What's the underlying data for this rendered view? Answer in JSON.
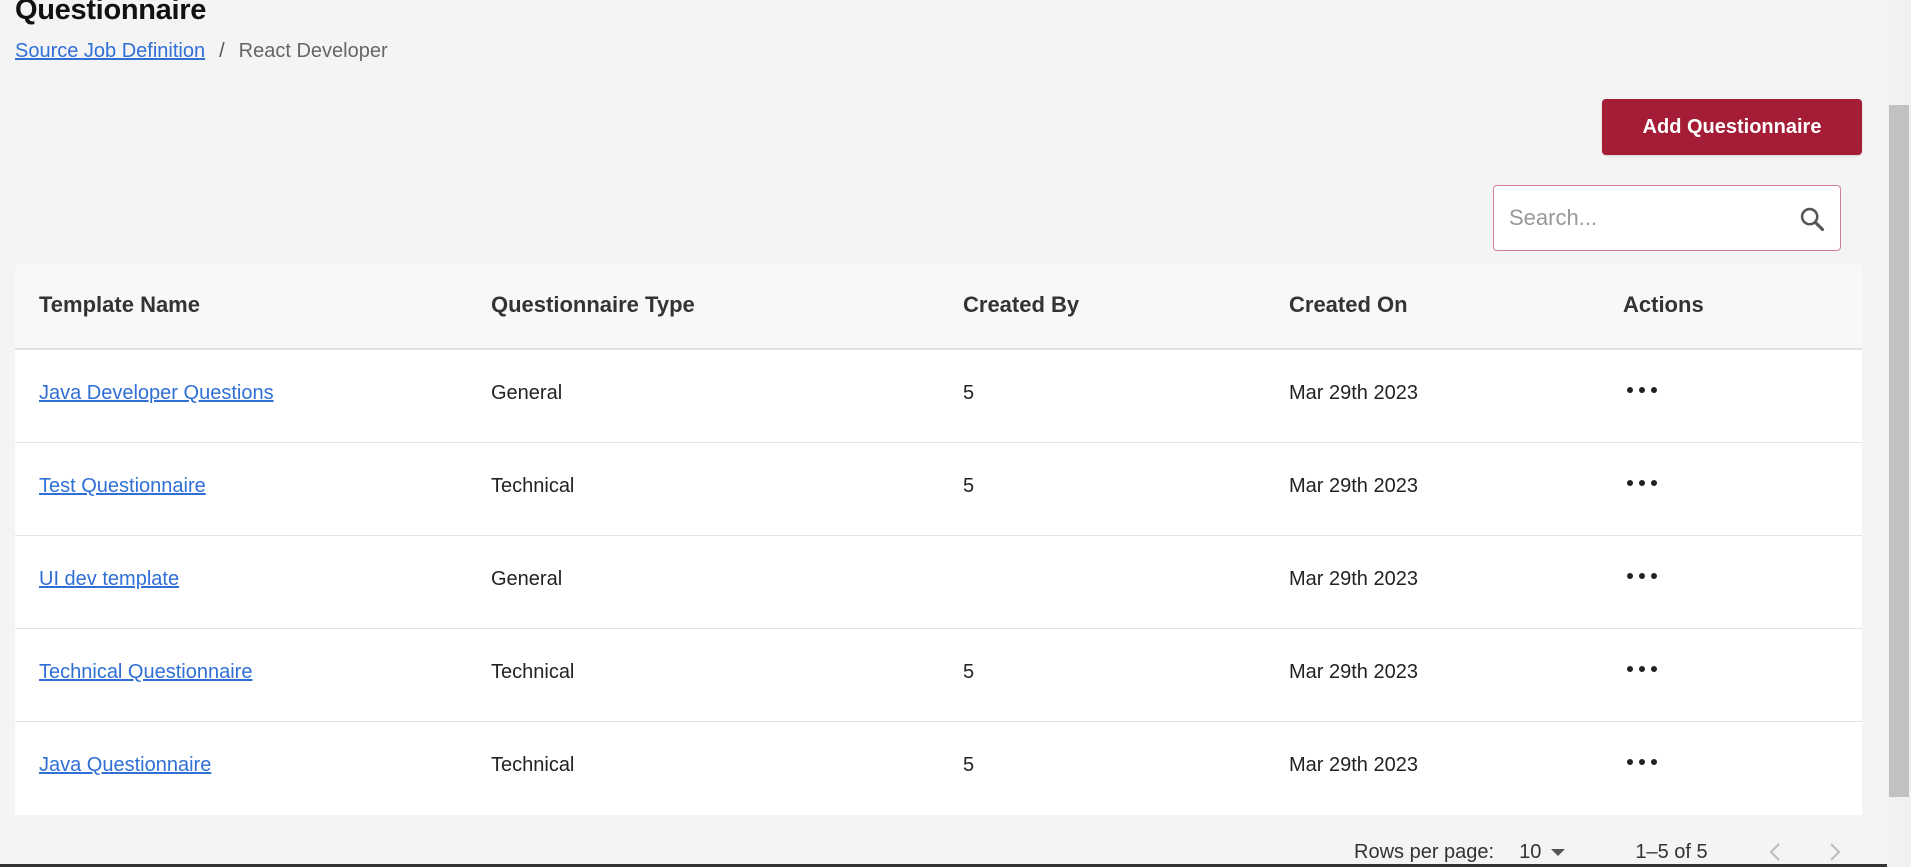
{
  "page": {
    "title": "Questionnaire"
  },
  "breadcrumb": {
    "parent": "Source Job Definition",
    "separator": "/",
    "current": "React Developer"
  },
  "toolbar": {
    "add_label": "Add Questionnaire"
  },
  "search": {
    "placeholder": "Search...",
    "value": ""
  },
  "table": {
    "headers": [
      "Template Name",
      "Questionnaire Type",
      "Created By",
      "Created On",
      "Actions"
    ],
    "rows": [
      {
        "name": "Java Developer Questions",
        "type": "General",
        "created_by": "5",
        "created_on": "Mar 29th 2023"
      },
      {
        "name": "Test Questionnaire",
        "type": "Technical",
        "created_by": "5",
        "created_on": "Mar 29th 2023"
      },
      {
        "name": "UI dev template",
        "type": "General",
        "created_by": "",
        "created_on": "Mar 29th 2023"
      },
      {
        "name": "Technical Questionnaire",
        "type": "Technical",
        "created_by": "5",
        "created_on": "Mar 29th 2023"
      },
      {
        "name": "Java Questionnaire",
        "type": "Technical",
        "created_by": "5",
        "created_on": "Mar 29th 2023"
      }
    ]
  },
  "pagination": {
    "rows_per_page_label": "Rows per page:",
    "rows_per_page_value": "10",
    "range": "1–5 of 5"
  },
  "colors": {
    "accent": "#a51c36",
    "link": "#2f6fd6"
  },
  "icons": {
    "search": "search-icon",
    "actions": "more-horizontal-icon",
    "prev": "chevron-left-icon",
    "next": "chevron-right-icon",
    "dropdown": "caret-down-icon"
  }
}
